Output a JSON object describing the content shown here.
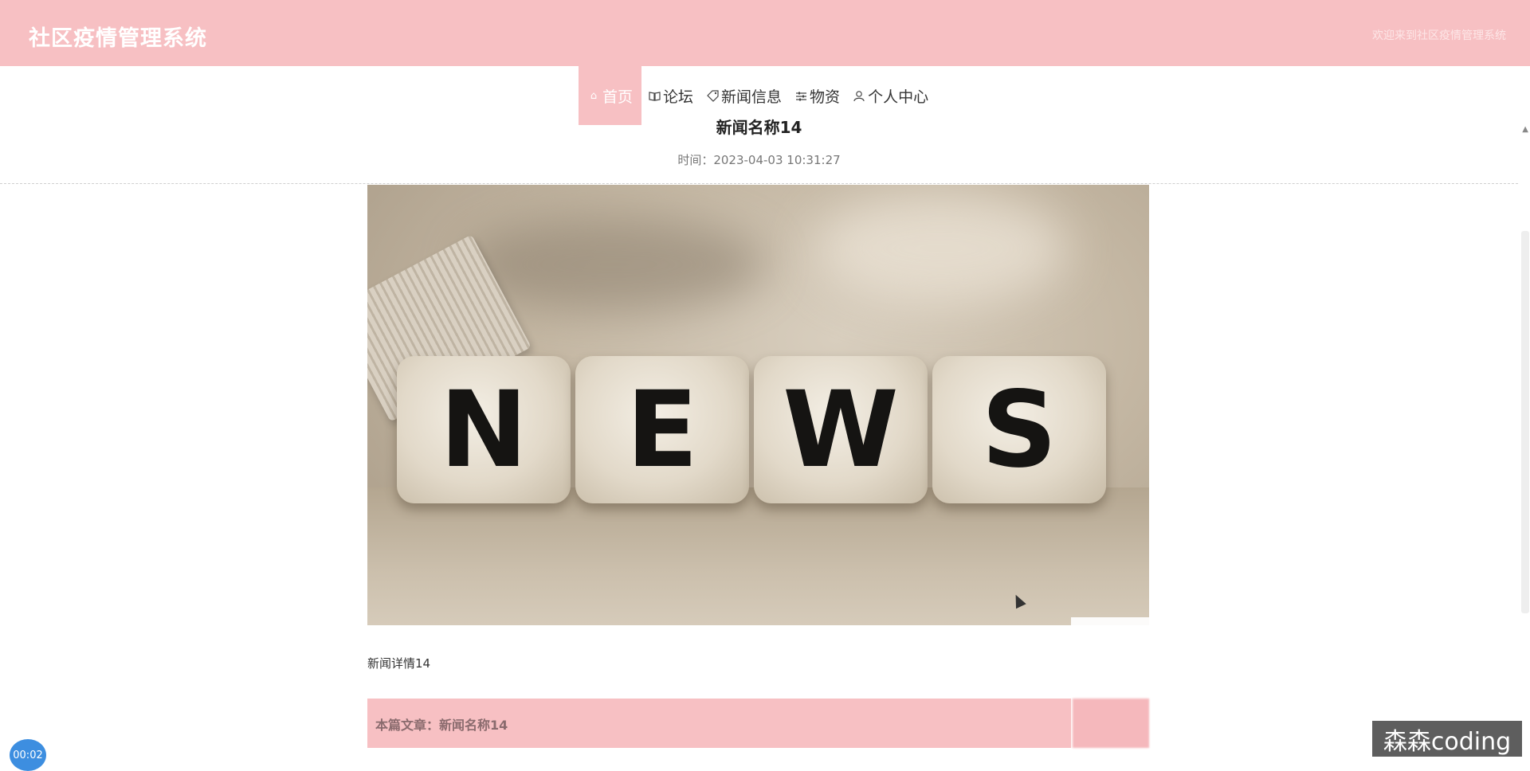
{
  "header": {
    "brand": "社区疫情管理系统",
    "welcome": "欢迎来到社区疫情管理系统"
  },
  "nav": {
    "items": [
      {
        "label": "首页",
        "icon": "home-icon",
        "active": true
      },
      {
        "label": "论坛",
        "icon": "book-icon",
        "active": false
      },
      {
        "label": "新闻信息",
        "icon": "tag-icon",
        "active": false
      },
      {
        "label": "物资",
        "icon": "sliders-icon",
        "active": false
      },
      {
        "label": "个人中心",
        "icon": "user-icon",
        "active": false
      }
    ]
  },
  "article": {
    "title": "新闻名称14",
    "time": "时间：2023-04-03 10:31:27",
    "image_letters": [
      "N",
      "E",
      "W",
      "S"
    ],
    "detail": "新闻详情14",
    "footer_label": "本篇文章：新闻名称14"
  },
  "overlay": {
    "timer": "00:02",
    "watermark": "森森coding"
  },
  "colors": {
    "accent": "#f7c0c3",
    "timer_badge": "#3d8ee0"
  }
}
